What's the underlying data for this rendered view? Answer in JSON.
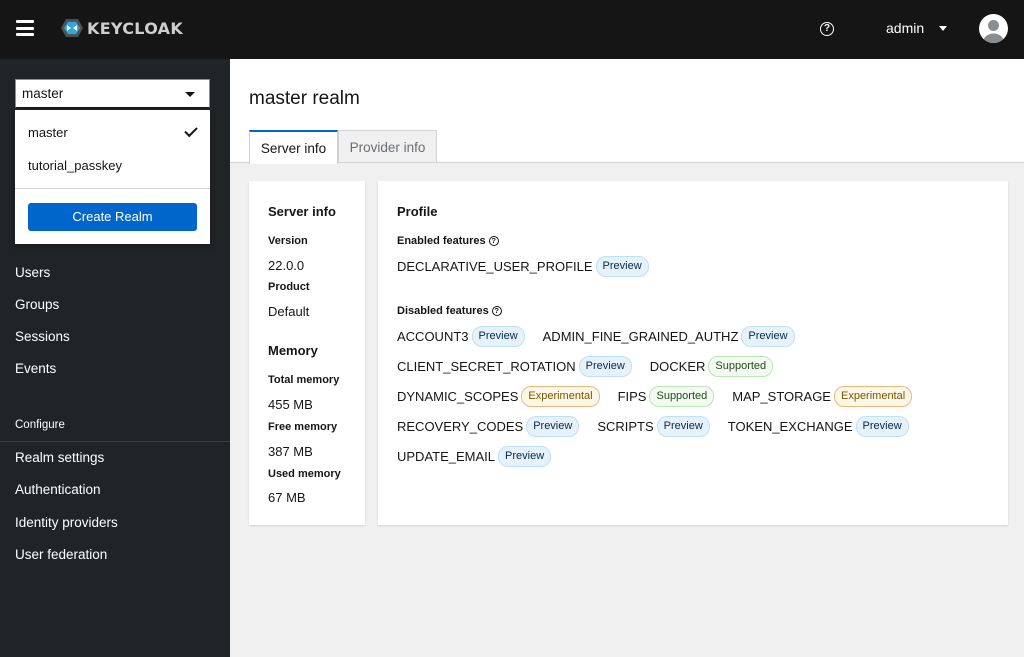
{
  "header": {
    "brand": "KEYCLOAK",
    "help_symbol": "?",
    "user": "admin"
  },
  "sidebar": {
    "realm_selector": {
      "value": "master"
    },
    "realm_menu": {
      "options": [
        "master",
        "tutorial_passkey"
      ],
      "create_button": "Create Realm"
    },
    "items": [
      "Users",
      "Groups",
      "Sessions",
      "Events"
    ],
    "configure_section": "Configure",
    "configure_items": [
      "Realm settings",
      "Authentication",
      "Identity providers",
      "User federation"
    ]
  },
  "page": {
    "title": "master realm",
    "tabs": [
      "Server info",
      "Provider info"
    ]
  },
  "server_info": {
    "title": "Server info",
    "version_label": "Version",
    "version": "22.0.0",
    "product_label": "Product",
    "product": "Default",
    "memory_title": "Memory",
    "total_label": "Total memory",
    "total": "455 MB",
    "free_label": "Free memory",
    "free": "387 MB",
    "used_label": "Used memory",
    "used": "67 MB"
  },
  "profile": {
    "title": "Profile",
    "enabled_label": "Enabled features",
    "enabled": [
      {
        "name": "DECLARATIVE_USER_PROFILE",
        "tag": "Preview"
      }
    ],
    "disabled_label": "Disabled features",
    "disabled": [
      {
        "name": "ACCOUNT3",
        "tag": "Preview"
      },
      {
        "name": "ADMIN_FINE_GRAINED_AUTHZ",
        "tag": "Preview"
      },
      {
        "name": "CLIENT_SECRET_ROTATION",
        "tag": "Preview"
      },
      {
        "name": "DOCKER",
        "tag": "Supported"
      },
      {
        "name": "DYNAMIC_SCOPES",
        "tag": "Experimental"
      },
      {
        "name": "FIPS",
        "tag": "Supported"
      },
      {
        "name": "MAP_STORAGE",
        "tag": "Experimental"
      },
      {
        "name": "RECOVERY_CODES",
        "tag": "Preview"
      },
      {
        "name": "SCRIPTS",
        "tag": "Preview"
      },
      {
        "name": "TOKEN_EXCHANGE",
        "tag": "Preview"
      },
      {
        "name": "UPDATE_EMAIL",
        "tag": "Preview"
      }
    ]
  },
  "colors": {
    "masthead": "#151515",
    "sidebar": "#212427",
    "primary": "#0066cc"
  }
}
